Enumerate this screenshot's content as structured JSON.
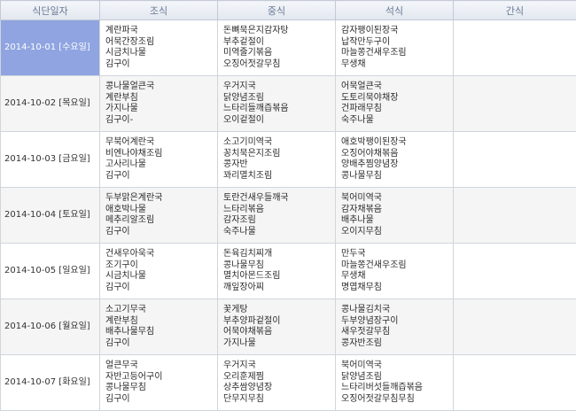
{
  "headers": {
    "date": "식단일자",
    "breakfast": "조식",
    "lunch": "중식",
    "dinner": "석식",
    "snack": "간식"
  },
  "rows": [
    {
      "date": "2014-10-01 [수요일]",
      "selected": true,
      "breakfast": [
        "계란파국",
        "어묵간장조림",
        "시금치나물",
        "김구이"
      ],
      "lunch": [
        "돈뼈묵은지감자탕",
        "부추겉절이",
        "미역줄기볶음",
        "오징어젓갈무침"
      ],
      "dinner": [
        "감자팽이된장국",
        "납작만두구이",
        "마늘쫑건새우조림",
        "무생채"
      ],
      "snack": []
    },
    {
      "date": "2014-10-02 [목요일]",
      "selected": false,
      "breakfast": [
        "콩나물얼큰국",
        "계란부침",
        "가지나물",
        "김구이-"
      ],
      "lunch": [
        "우거지국",
        "닭양념조림",
        "느타리들깨즙볶음",
        "오이겉절이"
      ],
      "dinner": [
        "어묵얼큰국",
        "도토리묵야채장",
        "건파래무침",
        "숙주나물"
      ],
      "snack": []
    },
    {
      "date": "2014-10-03 [금요일]",
      "selected": false,
      "breakfast": [
        "무북어계란국",
        "비엔나야채조림",
        "고사리나물",
        "김구이"
      ],
      "lunch": [
        "소고기미역국",
        "꽁치묵은지조림",
        "콩자반",
        "꽈리멸치조림"
      ],
      "dinner": [
        "애호박팽이된장국",
        "오징어야채볶음",
        "양배추찜양념장",
        "콩나물무침"
      ],
      "snack": []
    },
    {
      "date": "2014-10-04 [토요일]",
      "selected": false,
      "breakfast": [
        "두부맑은계란국",
        "애호박나물",
        "메추리알조림",
        "김구이"
      ],
      "lunch": [
        "토란건새우들깨국",
        "느타리볶음",
        "감자조림",
        "숙주나물"
      ],
      "dinner": [
        "북어미역국",
        "감자채볶음",
        "배추나물",
        "오이지무침"
      ],
      "snack": []
    },
    {
      "date": "2014-10-05 [일요일]",
      "selected": false,
      "breakfast": [
        "건새우아욱국",
        "조기구이",
        "시금치나물",
        "김구이"
      ],
      "lunch": [
        "돈육김치찌개",
        "콩나물무침",
        "멸치아몬드조림",
        "깨잎장아찌"
      ],
      "dinner": [
        "만두국",
        "마늘쫑건새우조림",
        "무생채",
        "명엽채무침"
      ],
      "snack": []
    },
    {
      "date": "2014-10-06 [월요일]",
      "selected": false,
      "breakfast": [
        "소고기무국",
        "계란부침",
        "배추나물무침",
        "김구이"
      ],
      "lunch": [
        "꽃게탕",
        "부추양파겉절이",
        "어묵야채볶음",
        "가지나물"
      ],
      "dinner": [
        "콩나물김치국",
        "두부양념장구이",
        "새우젓갈무침",
        "콩자반조림"
      ],
      "snack": []
    },
    {
      "date": "2014-10-07 [화요일]",
      "selected": false,
      "breakfast": [
        "얼큰무국",
        "자반고등어구이",
        "콩나물무침",
        "김구이"
      ],
      "lunch": [
        "우거지국",
        "오리훈제찜",
        "상추쌈양념장",
        "단무지무침"
      ],
      "dinner": [
        "북어미역국",
        "닭양념조림",
        "느타리버섯들깨즙볶음",
        "오징어젓갈무침무침"
      ],
      "snack": []
    }
  ]
}
